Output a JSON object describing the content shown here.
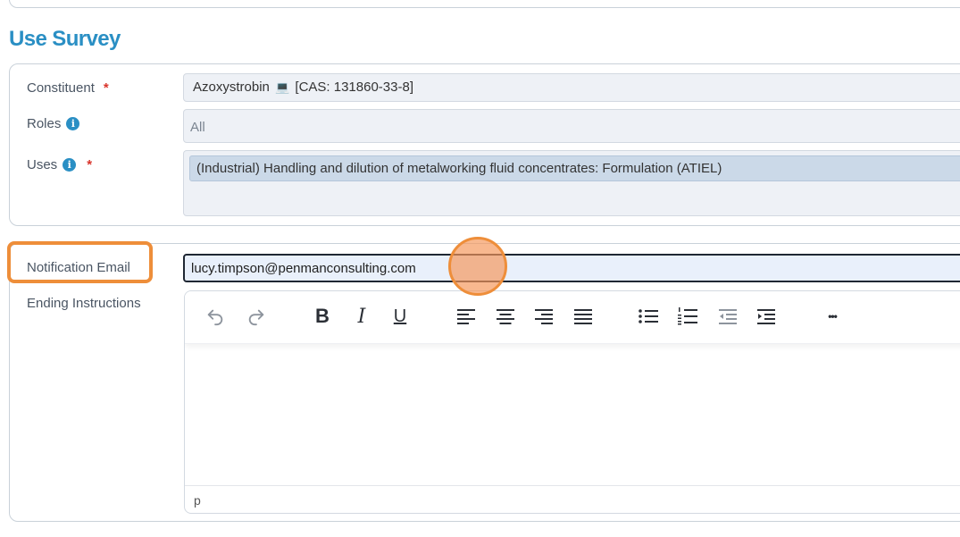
{
  "section_title": "Use Survey",
  "constituent": {
    "label": "Constituent",
    "required_marker": "*",
    "value_name": "Azoxystrobin",
    "value_icon": "laptop-icon",
    "value_cas": "[CAS: 131860-33-8]"
  },
  "roles": {
    "label": "Roles",
    "info_icon": "info-icon",
    "info_glyph": "i",
    "value": "All"
  },
  "uses": {
    "label": "Uses",
    "info_icon": "info-icon",
    "info_glyph": "i",
    "required_marker": "*",
    "selected": [
      "(Industrial) Handling and dilution of metalworking fluid concentrates: Formulation (ATIEL)"
    ]
  },
  "notification_email": {
    "label": "Notification Email",
    "value": "lucy.timpson@penmanconsulting.com"
  },
  "ending_instructions": {
    "label": "Ending Instructions",
    "toolbar": [
      "undo-icon",
      "redo-icon",
      "bold-icon",
      "italic-icon",
      "underline-icon",
      "align-left-icon",
      "align-center-icon",
      "align-right-icon",
      "align-justify-icon",
      "bullet-list-icon",
      "numbered-list-icon",
      "outdent-icon",
      "indent-icon",
      "more-icon"
    ],
    "bold_glyph": "B",
    "italic_glyph": "I",
    "underline_glyph": "U",
    "more_glyph": "•••",
    "status_path": "p"
  },
  "colors": {
    "accent": "#2a8fc4",
    "required": "#d9342b",
    "highlight": "#ee8e3a"
  }
}
